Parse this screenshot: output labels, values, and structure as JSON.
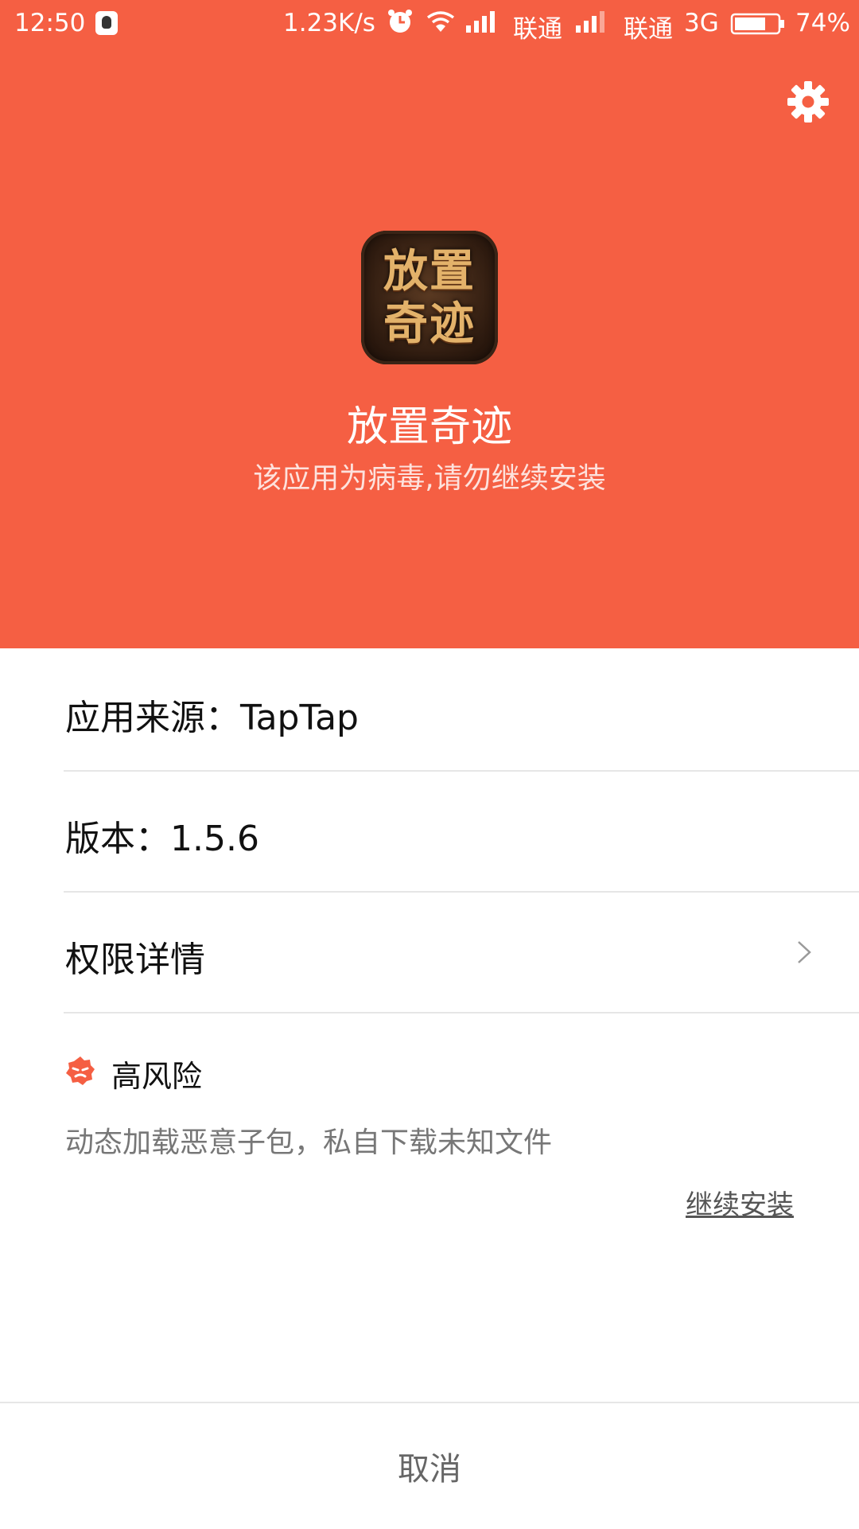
{
  "status_bar": {
    "time": "12:50",
    "speed": "1.23K/s",
    "carrier1": "联通",
    "carrier2": "联通",
    "network": "3G",
    "battery": "74%",
    "battery_level": 0.74,
    "icons": [
      "qq-icon",
      "alarm-icon",
      "wifi-icon",
      "signal-icon",
      "signal-icon",
      "battery-icon"
    ]
  },
  "header": {
    "background_color": "#f55f43",
    "settings_icon": "gear-icon",
    "app_icon_text_line1": "放置",
    "app_icon_text_line2": "奇迹",
    "app_name": "放置奇迹",
    "warning": "该应用为病毒,请勿继续安装"
  },
  "details": {
    "source_label": "应用来源：TapTap",
    "version_label": "版本：1.5.6",
    "permissions_label": "权限详情"
  },
  "risk": {
    "level": "高风险",
    "description": "动态加载恶意子包，私自下载未知文件",
    "icon": "risk-badge-icon"
  },
  "actions": {
    "continue_install": "继续安装",
    "cancel": "取消"
  }
}
